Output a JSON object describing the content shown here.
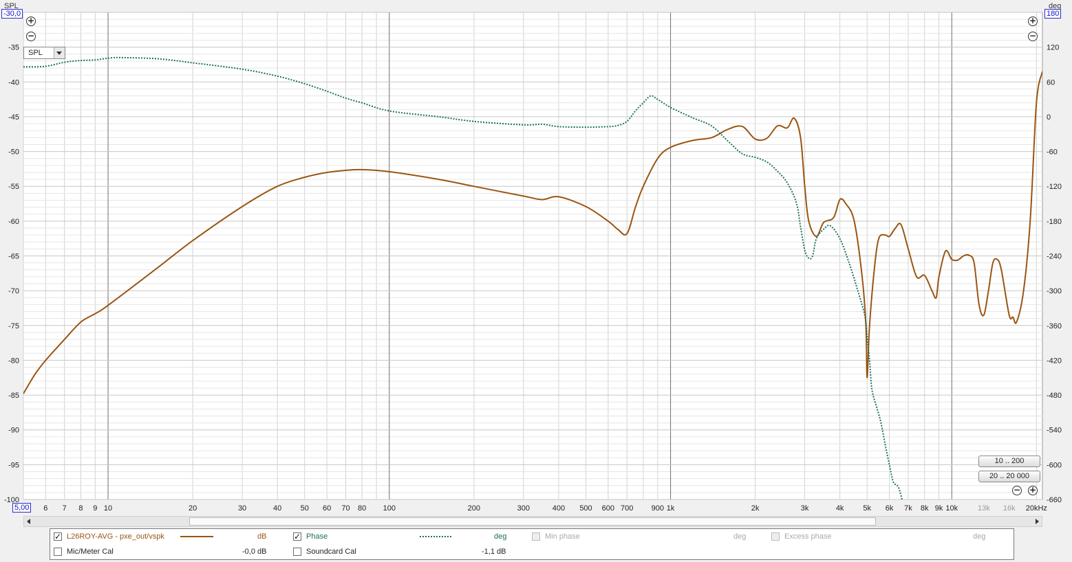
{
  "axes": {
    "left_title": "SPL",
    "right_title": "deg",
    "left_top_value": "-30,0",
    "right_top_value": "180",
    "x_min_value": "5,00",
    "x_unit_label": "kHz"
  },
  "controls": {
    "spl_select": "SPL",
    "range_btn_1": "10 .. 200",
    "range_btn_2": "20 .. 20 000"
  },
  "legend": {
    "row1": [
      {
        "label": "L26ROY-AVG - pxe_out/vspk",
        "unit": "dB",
        "checked": true
      },
      {
        "label": "Phase",
        "unit": "deg",
        "checked": true
      },
      {
        "label": "Min phase",
        "unit": "deg",
        "checked": false
      },
      {
        "label": "Excess phase",
        "unit": "deg",
        "checked": false
      }
    ],
    "row2": [
      {
        "label": "Mic/Meter Cal",
        "value": "-0,0 dB",
        "checked": false
      },
      {
        "label": "Soundcard Cal",
        "value": "-1,1 dB",
        "checked": false
      }
    ]
  },
  "chart_data": {
    "type": "line",
    "xscale": "log",
    "xlim": [
      5,
      21000
    ],
    "ylim": [
      -100,
      -30
    ],
    "y2lim": [
      -660,
      180
    ],
    "grid": true,
    "ylabel": "SPL",
    "y2label": "deg",
    "x_ticks": [
      "6",
      "7",
      "8",
      "9",
      "10",
      "20",
      "30",
      "40",
      "50",
      "60",
      "70",
      "80",
      "100",
      "200",
      "300",
      "400",
      "500",
      "600",
      "700",
      "900",
      "1k",
      "2k",
      "3k",
      "4k",
      "5k",
      "6k",
      "7k",
      "8k",
      "9k",
      "10k",
      "13k",
      "16k",
      "20kHz"
    ],
    "x_tick_values": [
      6,
      7,
      8,
      9,
      10,
      20,
      30,
      40,
      50,
      60,
      70,
      80,
      100,
      200,
      300,
      400,
      500,
      600,
      700,
      900,
      1000,
      2000,
      3000,
      4000,
      5000,
      6000,
      7000,
      8000,
      9000,
      10000,
      13000,
      16000,
      20000
    ],
    "x_ticks_dim": [
      "13k",
      "16k"
    ],
    "y_ticks": [
      -35,
      -40,
      -45,
      -50,
      -55,
      -60,
      -65,
      -70,
      -75,
      -80,
      -85,
      -90,
      -95,
      -100
    ],
    "y2_ticks": [
      120,
      60,
      0,
      -60,
      -120,
      -180,
      -240,
      -300,
      -360,
      -420,
      -480,
      -540,
      -600,
      -660
    ],
    "series": [
      {
        "name": "L26ROY-AVG - pxe_out/vspk",
        "axis": "left",
        "color": "#9a5412",
        "style": "solid",
        "x": [
          5.0,
          5.5,
          6,
          7,
          8,
          9,
          10,
          15,
          20,
          30,
          40,
          50,
          60,
          70,
          80,
          100,
          150,
          200,
          300,
          350,
          400,
          500,
          600,
          650,
          700,
          750,
          800,
          900,
          1000,
          1200,
          1400,
          1600,
          1800,
          2000,
          2200,
          2400,
          2600,
          2750,
          2900,
          3000,
          3100,
          3300,
          3500,
          3800,
          4000,
          4200,
          4500,
          4800,
          4950,
          5000,
          5100,
          5300,
          5500,
          5800,
          6000,
          6300,
          6600,
          7000,
          7500,
          8000,
          8500,
          8800,
          9000,
          9500,
          10000,
          10500,
          11000,
          11500,
          12000,
          12500,
          13000,
          13500,
          14000,
          14500,
          15000,
          16000,
          16500,
          17000,
          18000,
          19000,
          20000,
          21000
        ],
        "y": [
          -84.8,
          -82,
          -80,
          -77,
          -74.5,
          -73.3,
          -72.1,
          -66.7,
          -62.8,
          -57.9,
          -55,
          -53.7,
          -53,
          -52.7,
          -52.6,
          -52.9,
          -54,
          -55,
          -56.4,
          -56.9,
          -56.5,
          -57.9,
          -60,
          -61.2,
          -61.8,
          -58,
          -55,
          -51,
          -49.4,
          -48.4,
          -48,
          -46.8,
          -46.4,
          -48.2,
          -48.1,
          -46.3,
          -46.6,
          -45.2,
          -48,
          -55,
          -60,
          -62.2,
          -60.2,
          -59.5,
          -56.9,
          -57.5,
          -60,
          -68,
          -75,
          -82.5,
          -75,
          -67,
          -62.5,
          -62,
          -62.2,
          -61,
          -60.5,
          -64,
          -68,
          -67.8,
          -70,
          -71,
          -68,
          -64.3,
          -65.5,
          -65.6,
          -65,
          -64.9,
          -66,
          -72,
          -73.5,
          -70,
          -66,
          -65.5,
          -67,
          -73.5,
          -73.8,
          -74.5,
          -70,
          -60,
          -43,
          -38.5
        ]
      },
      {
        "name": "Phase",
        "axis": "right",
        "color": "#1b6f5e",
        "style": "dotted",
        "x": [
          5.0,
          6,
          7,
          8,
          9,
          10,
          11,
          15,
          20,
          30,
          40,
          50,
          60,
          70,
          80,
          100,
          150,
          200,
          300,
          350,
          400,
          500,
          600,
          650,
          700,
          750,
          800,
          850,
          900,
          1000,
          1200,
          1400,
          1600,
          1800,
          2000,
          2200,
          2400,
          2600,
          2800,
          2900,
          3000,
          3100,
          3200,
          3300,
          3500,
          3700,
          4000,
          4300,
          4600,
          4900,
          5000,
          5100,
          5200,
          5400,
          5600,
          5800,
          6000,
          6200,
          6500,
          7000,
          7500,
          8000,
          8500,
          8800,
          9000,
          9200,
          9500
        ],
        "y": [
          86,
          87,
          94,
          97,
          98,
          101,
          102,
          100,
          93,
          82,
          70,
          57,
          44,
          32,
          24,
          10,
          0,
          -8,
          -14,
          -13,
          -17,
          -18,
          -17,
          -15,
          -8,
          10,
          24,
          36,
          30,
          16,
          -2,
          -16,
          -42,
          -64,
          -70,
          -78,
          -94,
          -114,
          -148,
          -190,
          -230,
          -244,
          -240,
          -210,
          -194,
          -188,
          -210,
          -250,
          -295,
          -342,
          -378,
          -420,
          -470,
          -500,
          -528,
          -566,
          -600,
          -630,
          -642,
          -700,
          -700,
          -700,
          -700,
          -680,
          -665,
          -665,
          -700
        ]
      }
    ]
  }
}
